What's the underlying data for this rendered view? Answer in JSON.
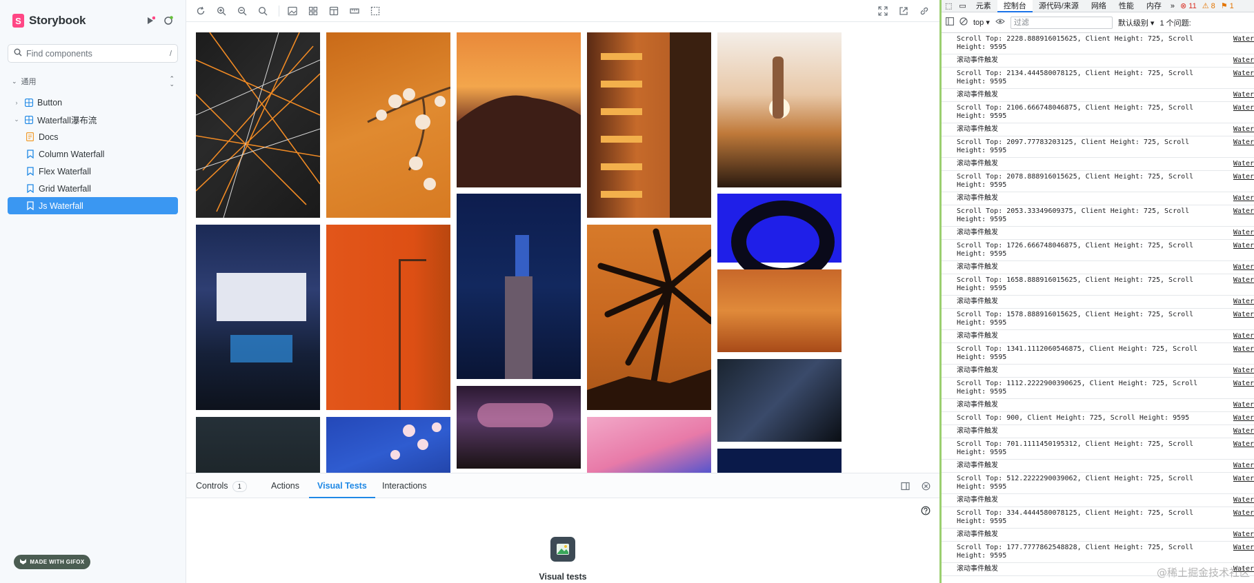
{
  "sidebar": {
    "brand": "Storybook",
    "search_placeholder": "Find components",
    "search_shortcut": "/",
    "group_label": "通用",
    "items": [
      {
        "label": "Button",
        "kind": "component",
        "chevron": "›"
      },
      {
        "label": "Waterfall瀑布流",
        "kind": "component",
        "chevron": "⌄"
      },
      {
        "label": "Docs",
        "kind": "docs"
      },
      {
        "label": "Column Waterfall",
        "kind": "story"
      },
      {
        "label": "Flex Waterfall",
        "kind": "story"
      },
      {
        "label": "Grid Waterfall",
        "kind": "story"
      },
      {
        "label": "Js Waterfall",
        "kind": "story",
        "selected": true
      }
    ],
    "gifox_badge": "MADE WITH GIFOX"
  },
  "toolbar": {
    "left_icons": [
      "refresh-icon",
      "zoom-in-icon",
      "zoom-out-icon",
      "zoom-reset-icon",
      "background-icon",
      "grid-icon",
      "viewport-icon",
      "measure-icon",
      "outline-icon"
    ],
    "right_icons": [
      "fullscreen-icon",
      "open-new-tab-icon",
      "copy-link-icon"
    ]
  },
  "addons": {
    "tabs": [
      {
        "label": "Controls",
        "count": "1"
      },
      {
        "label": "Actions"
      },
      {
        "label": "Visual Tests",
        "active": true
      },
      {
        "label": "Interactions"
      }
    ],
    "visual_tests_label": "Visual tests"
  },
  "devtools": {
    "tabs": [
      "元素",
      "控制台",
      "源代码/来源",
      "网络",
      "性能",
      "内存"
    ],
    "active_tab": "控制台",
    "errors": "11",
    "warnings": "8",
    "issues_flag": "1",
    "context": "top",
    "filter_placeholder": "过滤",
    "levels": "默认级别",
    "issues": "1 个问题:",
    "event_text": "滚动事件触发",
    "source": "Water",
    "logs": [
      "Scroll Top: 2228.888916015625, Client Height: 725, Scroll Height: 9595",
      "Scroll Top: 2134.444580078125, Client Height: 725, Scroll Height: 9595",
      "Scroll Top: 2106.666748046875, Client Height: 725, Scroll Height: 9595",
      "Scroll Top: 2097.77783203125, Client Height: 725, Scroll Height: 9595",
      "Scroll Top: 2078.888916015625, Client Height: 725, Scroll Height: 9595",
      "Scroll Top: 2053.33349609375, Client Height: 725, Scroll Height: 9595",
      "Scroll Top: 1726.666748046875, Client Height: 725, Scroll Height: 9595",
      "Scroll Top: 1658.888916015625, Client Height: 725, Scroll Height: 9595",
      "Scroll Top: 1578.888916015625, Client Height: 725, Scroll Height: 9595",
      "Scroll Top: 1341.1112060546875, Client Height: 725, Scroll Height: 9595",
      "Scroll Top: 1112.2222900390625, Client Height: 725, Scroll Height: 9595",
      "Scroll Top: 900, Client Height: 725, Scroll Height: 9595",
      "Scroll Top: 701.1111450195312, Client Height: 725, Scroll Height: 9595",
      "Scroll Top: 512.2222290039062, Client Height: 725, Scroll Height: 9595",
      "Scroll Top: 334.4444580078125, Client Height: 725, Scroll Height: 9595",
      "Scroll Top: 177.7777862548828, Client Height: 725, Scroll Height: 9595"
    ],
    "watermark": "@稀土掘金技术社区"
  }
}
